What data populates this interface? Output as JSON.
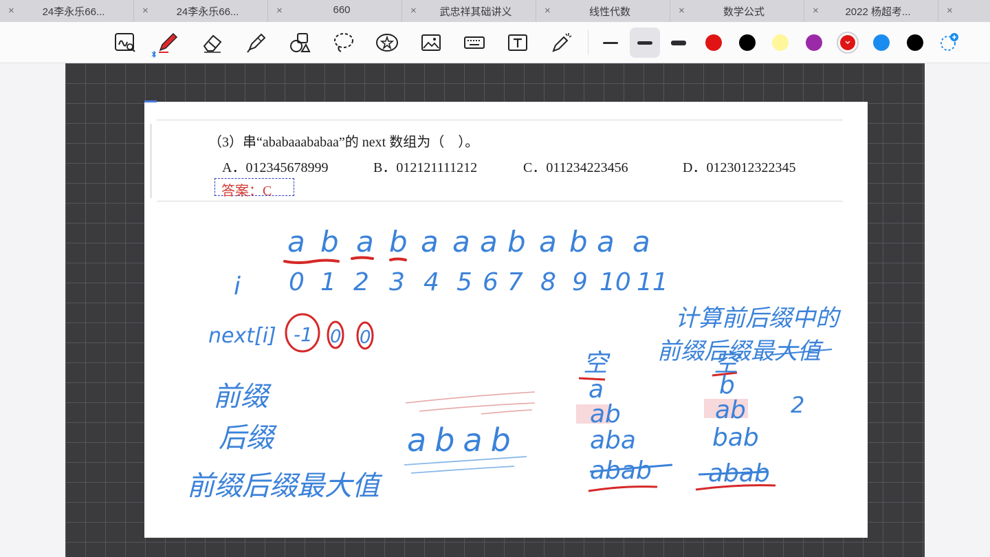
{
  "tabs": [
    {
      "title": "24李永乐66...",
      "close": "×"
    },
    {
      "title": "24李永乐66...",
      "close": "×"
    },
    {
      "title": "660",
      "close": "×"
    },
    {
      "title": "武忠祥其础讲义",
      "close": "×"
    },
    {
      "title": "线性代数",
      "close": "×"
    },
    {
      "title": "数学公式",
      "close": "×"
    },
    {
      "title": "2022 杨超考...",
      "close": "×"
    },
    {
      "title": "",
      "close": "×"
    }
  ],
  "toolbar": {
    "tools": [
      "zoom-pen-icon",
      "pen-icon",
      "eraser-icon",
      "highlighter-icon",
      "shapes-icon",
      "lasso-icon",
      "sticker-icon",
      "image-icon",
      "keyboard-icon",
      "text-icon",
      "laser-pointer-icon"
    ],
    "stroke_widths": [
      "thin",
      "medium",
      "thick"
    ],
    "selected_stroke": "medium",
    "colors": [
      "#e01414",
      "#000000",
      "#fff79a",
      "#9b2aa8",
      "#e01414",
      "#1a8cf0",
      "#000000"
    ],
    "selected_color_index": 4,
    "add_color_icon": "add-color-icon"
  },
  "document": {
    "question": "（3）串“ababaaababaa”的 next 数组为（　）。",
    "options": [
      "A．012345678999",
      "B．012121111212",
      "C．011234223456",
      "D．0123012322345"
    ],
    "answer": "答案：C"
  },
  "handwriting": {
    "string_chars": [
      "a",
      "b",
      "a",
      "b",
      "a",
      "a",
      "a",
      "b",
      "a",
      "b",
      "a",
      "a"
    ],
    "i_label": "i",
    "indices": [
      "0",
      "1",
      "2",
      "3",
      "4",
      "5",
      "6",
      "7",
      "8",
      "9",
      "10",
      "11"
    ],
    "next_label": "next[i]",
    "next_values": [
      "-1",
      "0",
      "0"
    ],
    "note_line1": "计算前后缀中的",
    "note_line2": "前缀后缀最大值",
    "prefix": "前缀",
    "suffix": "后缀",
    "prefix_suffix_max": "前缀后缀最大值",
    "example": "abab",
    "prefix_list": [
      "空",
      "a",
      "ab",
      "aba",
      "abab"
    ],
    "suffix_list": [
      "空",
      "b",
      "ab",
      "bab",
      "abab"
    ],
    "result": "2"
  }
}
